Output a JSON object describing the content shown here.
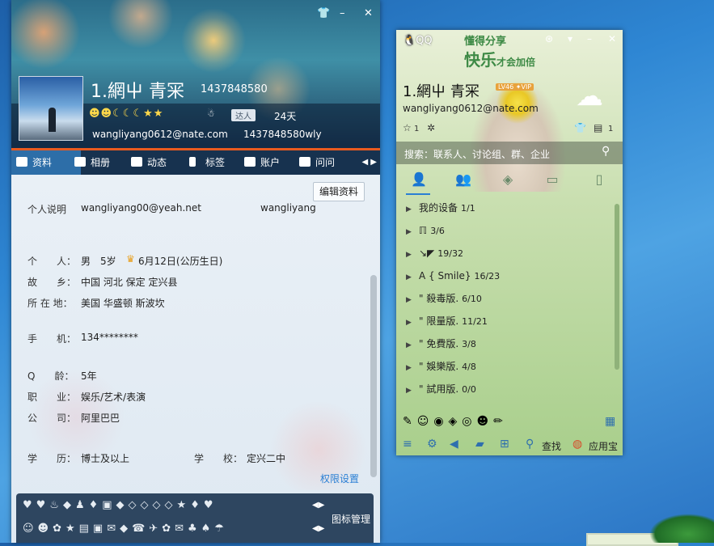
{
  "profile_window": {
    "display_name": "1.網屮 青冞",
    "qq_number": "1437848580",
    "level_icons": "☻☻☾☾☾★★",
    "daren_badge": "达人",
    "days": "24天",
    "email": "wangliyang0612@nate.com",
    "nickname_id": "1437848580wly",
    "tabs": [
      {
        "label": "资料"
      },
      {
        "label": "相册"
      },
      {
        "label": "动态"
      },
      {
        "label": "标签"
      },
      {
        "label": "账户"
      },
      {
        "label": "问问"
      }
    ],
    "edit_button": "编辑资料",
    "fields": {
      "intro_label": "个人说明",
      "intro_value": "wangliyang00@yeah.net",
      "intro_extra": "wangliyang",
      "person_label": "个　　人：",
      "person_value": "男　5岁",
      "birthday": "6月12日(公历生日)",
      "hometown_label": "故　　乡：",
      "hometown_value": "中国 河北 保定 定兴县",
      "location_label": "所 在 地：",
      "location_value": "美国 华盛顿 斯波坎",
      "mobile_label": "手　　机：",
      "mobile_value": "134********",
      "qage_label": "Q　　龄：",
      "qage_value": "5年",
      "job_label": "职　　业：",
      "job_value": "娱乐/艺术/表演",
      "company_label": "公　　司：",
      "company_value": "阿里巴巴",
      "edu_label": "学　　历：",
      "edu_value": "博士及以上",
      "school_label": "学　　校：",
      "school_value": "定兴二中"
    },
    "permission_link": "权限设置",
    "icon_row1": "♥♥♨◆♟♦▣◆◇◇◇◇★♦♥",
    "icon_row2": "☺☻✿★▤▣✉◆☎✈✿✉♣♠☂",
    "icon_manage": "图标管理"
  },
  "qq_panel": {
    "logo": "QQ",
    "slogan_line1": "懂得分享",
    "slogan_line2": "快乐",
    "slogan_small": "才会加倍",
    "name": "1.網屮 青冞",
    "vip": "LV46 ✦VIP",
    "email": "wangliyang0612@nate.com",
    "star_count": "1",
    "box_count": "1",
    "search_placeholder": "搜索：联系人、讨论组、群、企业",
    "groups": [
      {
        "name": "我的设备",
        "count": "1/1"
      },
      {
        "name": "ℿ",
        "count": "3/6"
      },
      {
        "name": "↘◤",
        "count": "19/32"
      },
      {
        "name": "A { Smile}",
        "count": "16/23"
      },
      {
        "name": "\" 殺毒版.",
        "count": "6/10"
      },
      {
        "name": "\" 限量版.",
        "count": "11/21"
      },
      {
        "name": "\" 免費版.",
        "count": "3/8"
      },
      {
        "name": "\" 娛樂版.",
        "count": "4/8"
      },
      {
        "name": "\" 試用版.",
        "count": "0/0"
      }
    ],
    "apps_row": "✎☺◉◈◎☻✏",
    "find_label": "查找",
    "appstore_label": "应用宝"
  }
}
